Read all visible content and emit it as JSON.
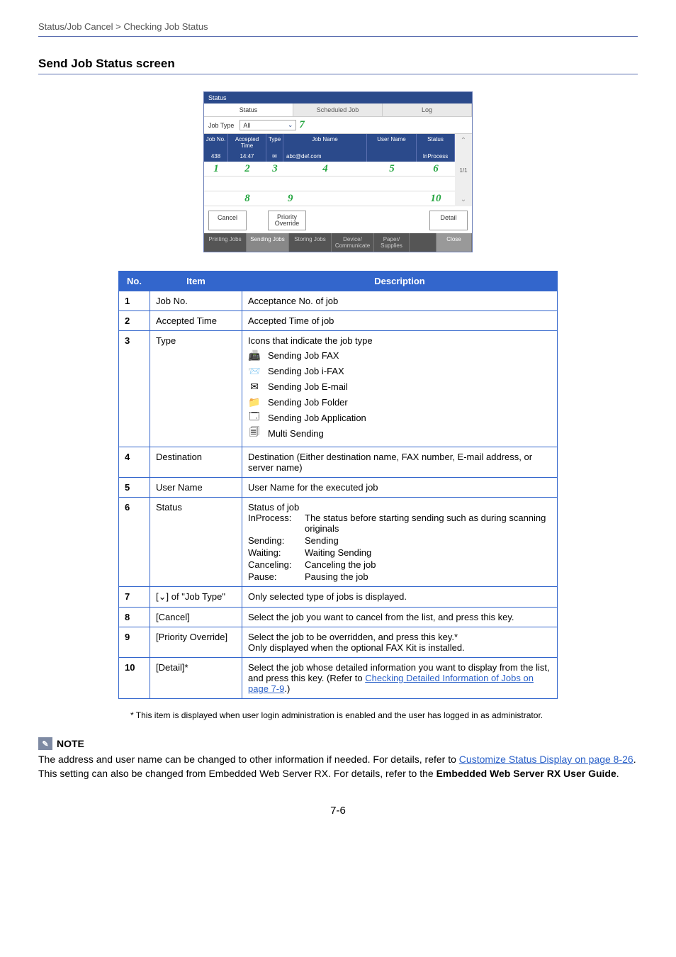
{
  "breadcrumb": "Status/Job Cancel > Checking Job Status",
  "section_title": "Send Job Status screen",
  "screenshot": {
    "title": "Status",
    "tabs": {
      "status": "Status",
      "scheduled": "Scheduled Job",
      "log": "Log"
    },
    "job_type_label": "Job Type",
    "job_type_value": "All",
    "cols": {
      "jobno": "Job No.",
      "time": "Accepted Time",
      "type": "Type",
      "name": "Job Name",
      "user": "User Name",
      "status": "Status"
    },
    "row": {
      "jobno": "438",
      "time": "14:47",
      "name": "abc@def.com",
      "status": "InProcess"
    },
    "page_ind": "1/1",
    "buttons": {
      "cancel": "Cancel",
      "priority": "Priority\nOverride",
      "detail": "Detail"
    },
    "footer": {
      "printing": "Printing Jobs",
      "sending": "Sending Jobs",
      "storing": "Storing Jobs",
      "device": "Device/\nCommunicate",
      "paper": "Paper/\nSupplies",
      "close": "Close"
    },
    "nums": {
      "n1": "1",
      "n2": "2",
      "n3": "3",
      "n4": "4",
      "n5": "5",
      "n6": "6",
      "n7": "7",
      "n8": "8",
      "n9": "9",
      "n10": "10"
    }
  },
  "table": {
    "head": {
      "no": "No.",
      "item": "Item",
      "desc": "Description"
    },
    "rows": [
      {
        "no": "1",
        "item": "Job No.",
        "desc": "Acceptance No. of job"
      },
      {
        "no": "2",
        "item": "Accepted Time",
        "desc": "Accepted Time of job"
      },
      {
        "no": "3",
        "item": "Type",
        "type_intro": "Icons that indicate the job type",
        "types": [
          {
            "icon": "📠",
            "label": "Sending Job FAX"
          },
          {
            "icon": "📨",
            "label": "Sending Job i-FAX"
          },
          {
            "icon": "✉",
            "label": "Sending Job E-mail"
          },
          {
            "icon": "📁",
            "label": "Sending Job Folder"
          },
          {
            "icon": "🗔",
            "label": "Sending Job Application"
          },
          {
            "icon": "🗐",
            "label": "Multi Sending"
          }
        ]
      },
      {
        "no": "4",
        "item": "Destination",
        "desc": "Destination (Either destination name, FAX number, E-mail address, or server name)"
      },
      {
        "no": "5",
        "item": "User Name",
        "desc": "User Name for the executed job"
      },
      {
        "no": "6",
        "item": "Status",
        "status_intro": "Status of job",
        "statuses": [
          {
            "k": "InProcess:",
            "v": "The status before starting sending such as during scanning originals"
          },
          {
            "k": "Sending:",
            "v": "Sending"
          },
          {
            "k": "Waiting:",
            "v": "Waiting Sending"
          },
          {
            "k": "Canceling:",
            "v": "Canceling the job"
          },
          {
            "k": "Pause:",
            "v": "Pausing the job"
          }
        ]
      },
      {
        "no": "7",
        "item": "[❤] of \"Job Type\"",
        "item_plain": "of \"Job Type\"",
        "desc": "Only selected type of jobs is displayed."
      },
      {
        "no": "8",
        "item": "[Cancel]",
        "desc": "Select the job you want to cancel from the list, and press this key."
      },
      {
        "no": "9",
        "item": "[Priority Override]",
        "desc": "Select the job to be overridden, and press this key.*\nOnly displayed when the optional FAX Kit is installed."
      },
      {
        "no": "10",
        "item": "[Detail]*",
        "desc_pre": "Select the job whose detailed information you want to display from the list, and press this key. (Refer to ",
        "link": "Checking Detailed Information of Jobs on page 7-9",
        "desc_post": ".)"
      }
    ]
  },
  "footnote": "*  This item is displayed when user login administration is enabled and the user has logged in as administrator.",
  "note": {
    "head": "NOTE",
    "pre": "The address and user name can be changed to other information if needed. For details, refer to ",
    "link": "Customize Status Display on page 8-26",
    "mid": ". This setting can also be changed from Embedded Web Server RX. For details, refer to the ",
    "bold": "Embedded Web Server RX User Guide",
    "post": "."
  },
  "page_num": "7-6"
}
